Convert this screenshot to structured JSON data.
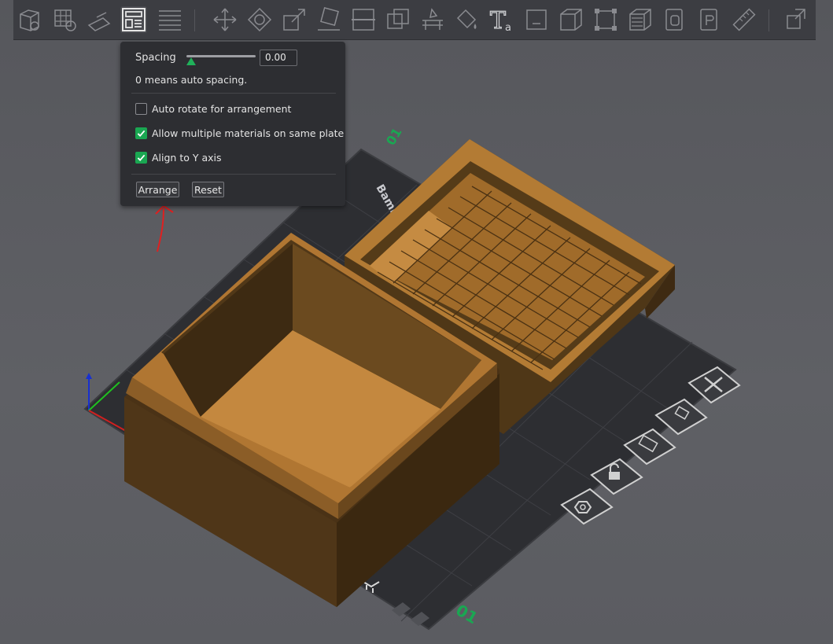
{
  "toolbar": {
    "tools": [
      {
        "icon": "add-cube-icon",
        "active": false
      },
      {
        "icon": "add-plate-icon",
        "active": false
      },
      {
        "icon": "orient-icon",
        "active": false
      },
      {
        "icon": "arrange-icon",
        "active": true
      },
      {
        "icon": "split-plates-icon",
        "active": false
      },
      {
        "icon": "move-icon",
        "active": false
      },
      {
        "icon": "rotate-icon",
        "active": false
      },
      {
        "icon": "scale-icon",
        "active": false
      },
      {
        "icon": "lay-on-face-icon",
        "active": false
      },
      {
        "icon": "cut-icon",
        "active": false
      },
      {
        "icon": "boolean-icon",
        "active": false
      },
      {
        "icon": "support-paint-icon",
        "active": false
      },
      {
        "icon": "color-paint-icon",
        "active": false
      },
      {
        "icon": "text-icon",
        "active": false
      },
      {
        "icon": "variable-layer-icon",
        "active": false
      },
      {
        "icon": "split-objects-icon",
        "active": false
      },
      {
        "icon": "fix-model-icon",
        "active": false
      },
      {
        "icon": "seam-paint-icon",
        "active": false
      },
      {
        "icon": "fuzzy-skin-icon",
        "active": false
      },
      {
        "icon": "emboss-icon",
        "active": false
      },
      {
        "icon": "measure-icon",
        "active": false
      },
      {
        "icon": "assembly-icon",
        "active": false
      }
    ],
    "text_tool_glyph": "T",
    "text_tool_sub": "a"
  },
  "arrange_popup": {
    "spacing_label": "Spacing",
    "spacing_value": "0.00",
    "spacing_slider_fraction": 0,
    "spacing_hint": "0 means auto spacing.",
    "options": [
      {
        "label": "Auto rotate for arrangement",
        "checked": false
      },
      {
        "label": "Allow multiple materials on same plate",
        "checked": true
      },
      {
        "label": "Align to Y axis",
        "checked": true
      }
    ],
    "arrange_button": "Arrange",
    "reset_button": "Reset"
  },
  "plate": {
    "name_text": "Bambu Textu",
    "plate_number": "01",
    "plate_number_top": "01"
  },
  "plate_tools": [
    {
      "icon": "delete-plate-icon"
    },
    {
      "icon": "auto-orient-plate-icon"
    },
    {
      "icon": "arrange-plate-icon"
    },
    {
      "icon": "lock-plate-icon"
    },
    {
      "icon": "plate-settings-icon"
    }
  ],
  "colors": {
    "model": "#b07a36",
    "model_dark": "#4a3418",
    "bed": "#2e2f33",
    "accent_green": "#1aa752",
    "annotation_red": "#e02020"
  }
}
